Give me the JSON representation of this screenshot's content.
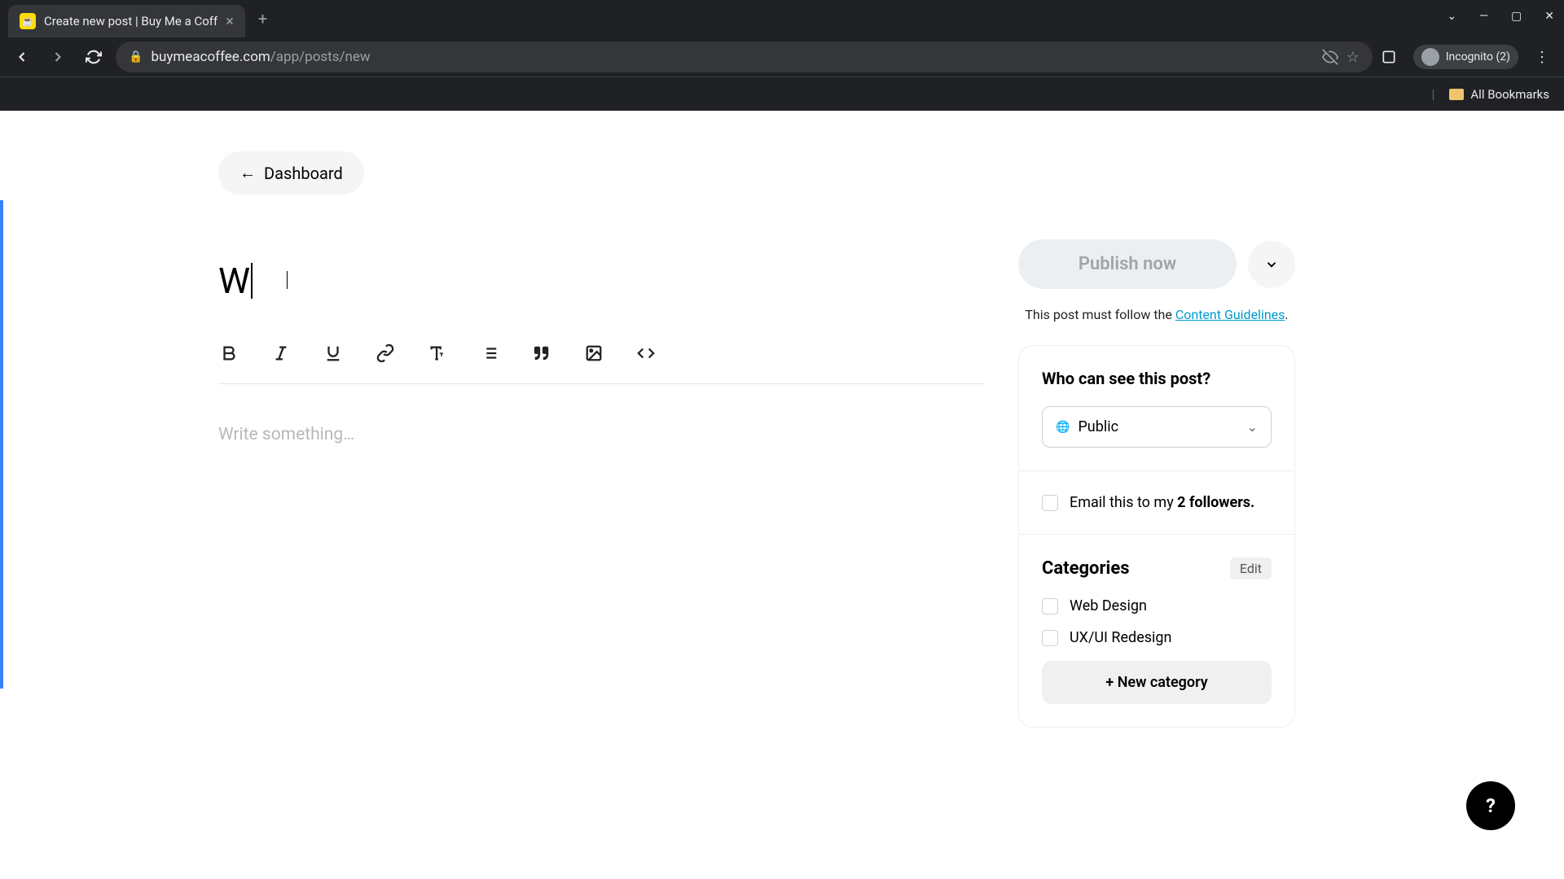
{
  "browser": {
    "tab_title": "Create new post | Buy Me a Coff",
    "url_domain": "buymeacoffee.com",
    "url_path": "/app/posts/new",
    "incognito_label": "Incognito (2)",
    "all_bookmarks": "All Bookmarks"
  },
  "header": {
    "back_label": "Dashboard"
  },
  "editor": {
    "title_value": "W",
    "body_placeholder": "Write something…"
  },
  "sidebar": {
    "publish_label": "Publish now",
    "guidelines_prefix": "This post must follow the ",
    "guidelines_link": "Content Guidelines",
    "visibility": {
      "heading": "Who can see this post?",
      "selected": "Public"
    },
    "email": {
      "prefix": "Email this to my ",
      "bold": "2 followers."
    },
    "categories": {
      "heading": "Categories",
      "edit_label": "Edit",
      "items": [
        "Web Design",
        "UX/UI Redesign"
      ],
      "new_label": "+ New category"
    }
  },
  "help": {
    "label": "?"
  }
}
